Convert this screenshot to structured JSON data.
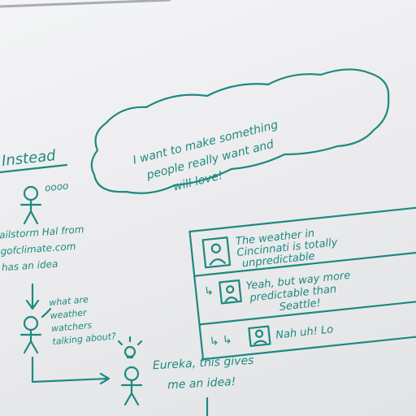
{
  "board": {
    "heading": "Instead",
    "thought_dots": "oooo",
    "bubble_lines": [
      "I want to make something",
      "people really want and",
      "will love!"
    ],
    "stick_label_lines": [
      "ailstorm Hal from",
      "gofclimate.com",
      "has an idea"
    ],
    "question_lines": [
      "what are",
      "weather",
      "watchers",
      "talking about?"
    ],
    "eureka_lines": [
      "Eureka, this gives",
      "me an idea!"
    ],
    "posts": [
      {
        "prefix": "",
        "lines": [
          "The weather in",
          "Cincinnati is totally",
          "unpredictable"
        ]
      },
      {
        "prefix": "↳",
        "lines": [
          "Yeah, but way more",
          "predictable than",
          "Seattle!"
        ]
      },
      {
        "prefix": "↳ ↳",
        "lines": [
          "Nah uh! Lo"
        ]
      }
    ]
  }
}
